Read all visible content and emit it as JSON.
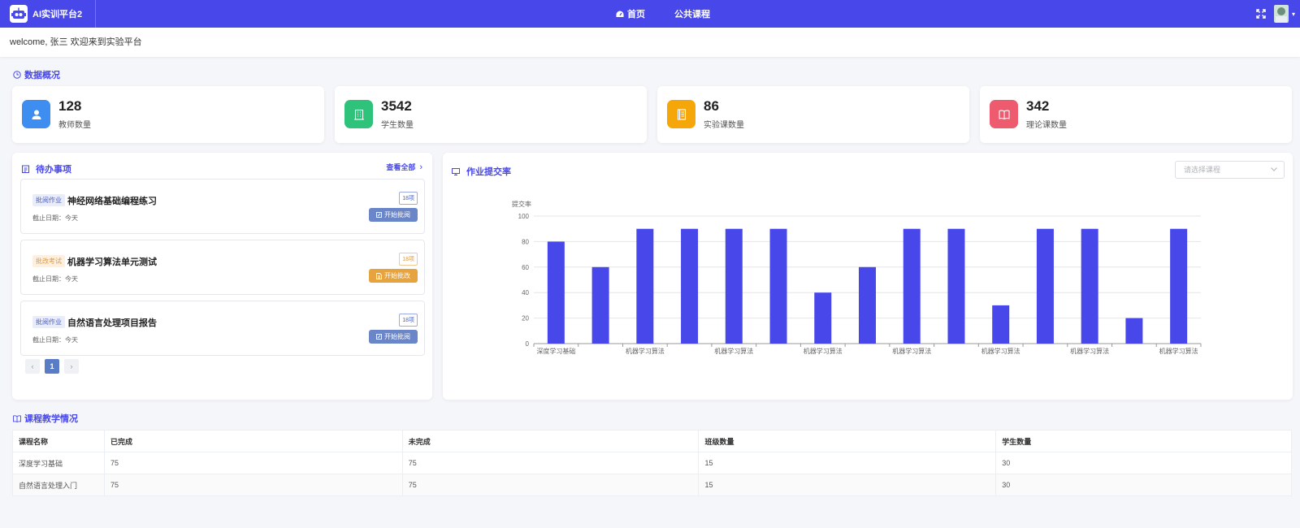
{
  "header": {
    "app_title": "AI实训平台2",
    "nav": [
      {
        "label": "首页",
        "icon": "dashboard-icon"
      },
      {
        "label": "公共课程"
      }
    ],
    "colors": {
      "primary": "#4848ea"
    }
  },
  "welcome": {
    "text": "welcome, 张三 欢迎来到实验平台"
  },
  "overview": {
    "title": "数据概况",
    "stats": [
      {
        "value": "128",
        "label": "教师数量",
        "color": "#3d8ef0",
        "icon": "user-icon"
      },
      {
        "value": "3542",
        "label": "学生数量",
        "color": "#2fc27a",
        "icon": "building-icon"
      },
      {
        "value": "86",
        "label": "实验课数量",
        "color": "#f5a70a",
        "icon": "notebook-icon"
      },
      {
        "value": "342",
        "label": "理论课数量",
        "color": "#ee5a6e",
        "icon": "book-icon"
      }
    ]
  },
  "todo": {
    "title": "待办事项",
    "view_all": "查看全部",
    "items": [
      {
        "tag": "批阅作业",
        "title": "神经网络基础编程练习",
        "date": "截止日期：今天",
        "count": "18项",
        "button": "开始批阅"
      },
      {
        "tag": "批改考试",
        "title": "机器学习算法单元测试",
        "date": "截止日期：今天",
        "count": "18项",
        "button": "开始批改"
      },
      {
        "tag": "批阅作业",
        "title": "自然语言处理项目报告",
        "date": "截止日期：今天",
        "count": "18项",
        "button": "开始批阅"
      }
    ],
    "pagination": {
      "prev": "‹",
      "current": "1",
      "next": "›"
    }
  },
  "submission": {
    "title": "作业提交率",
    "select_placeholder": "请选择课程"
  },
  "chart_data": {
    "type": "bar",
    "title": "",
    "ylabel": "提交率",
    "xlabel": "",
    "ylim": [
      0,
      100
    ],
    "yticks": [
      0,
      20,
      40,
      60,
      80,
      100
    ],
    "categories": [
      "深度学习基础",
      "",
      "机器学习算法",
      "",
      "机器学习算法",
      "",
      "机器学习算法",
      "",
      "机器学习算法",
      "",
      "机器学习算法",
      "",
      "机器学习算法",
      "",
      "机器学习算法"
    ],
    "values": [
      80,
      60,
      90,
      90,
      90,
      90,
      40,
      60,
      90,
      90,
      30,
      90,
      90,
      20,
      90
    ],
    "color": "#4848ea",
    "grid": true
  },
  "courses": {
    "title": "课程教学情况",
    "columns": [
      "课程名称",
      "已完成",
      "未完成",
      "班级数量",
      "学生数量"
    ],
    "rows": [
      [
        "深度学习基础",
        "75",
        "75",
        "15",
        "30"
      ],
      [
        "自然语言处理入门",
        "75",
        "75",
        "15",
        "30"
      ]
    ]
  }
}
